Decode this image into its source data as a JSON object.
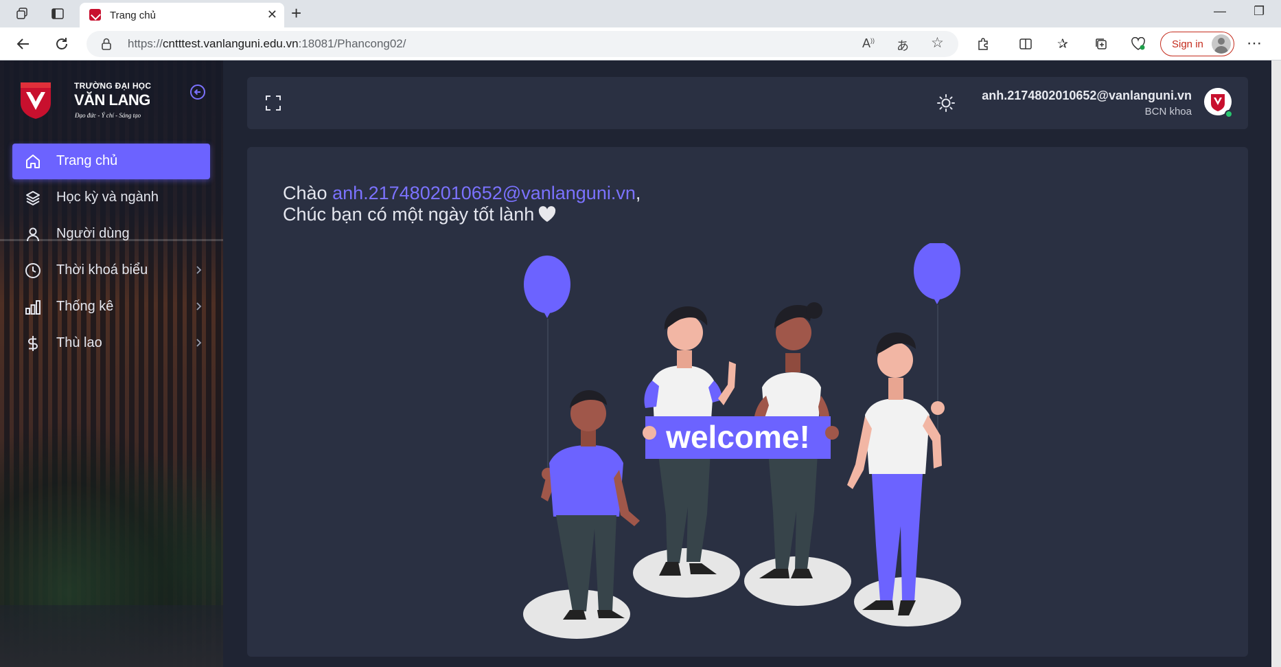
{
  "browser": {
    "tab_title": "Trang chủ",
    "url_prefix": "https://",
    "url_host": "cntttest.vanlanguni.edu.vn",
    "url_path": ":18081/Phancong02/",
    "signin_label": "Sign in"
  },
  "sidebar": {
    "logo_line1": "TRƯỜNG ĐẠI HỌC",
    "logo_line2": "VĂN LANG",
    "logo_tagline": "Đạo đức - Ý chí - Sáng tạo",
    "items": [
      {
        "label": "Trang chủ",
        "icon": "home-icon",
        "active": true
      },
      {
        "label": "Học kỳ và ngành",
        "icon": "layers-icon"
      },
      {
        "label": "Người dùng",
        "icon": "user-icon"
      },
      {
        "label": "Thời khoá biểu",
        "icon": "clock-icon",
        "has_submenu": true
      },
      {
        "label": "Thống kê",
        "icon": "bar-chart-icon",
        "has_submenu": true
      },
      {
        "label": "Thù lao",
        "icon": "dollar-icon",
        "has_submenu": true
      }
    ]
  },
  "header": {
    "user_email": "anh.2174802010652@vanlanguni.vn",
    "user_role": "BCN khoa"
  },
  "main": {
    "greeting_prefix": "Chào ",
    "greeting_email": "anh.2174802010652@vanlanguni.vn",
    "greeting_suffix": ",",
    "greeting_line2": "Chúc bạn có một ngày tốt lành",
    "banner_text": "welcome!"
  },
  "colors": {
    "accent": "#6c63ff",
    "sidebar_bg": "#161a28",
    "card_bg": "#2a3042",
    "page_bg": "#1f2433",
    "online": "#28c76f"
  }
}
